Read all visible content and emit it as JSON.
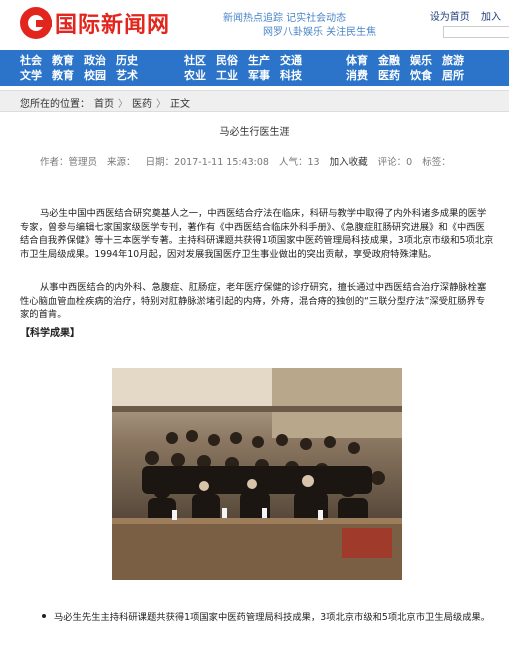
{
  "header": {
    "logo_text": "国际新闻网",
    "promo_line1": "新闻热点追踪 记实社会动态",
    "promo_line2": "网罗八卦娱乐 关注民生焦",
    "top_links": [
      "设为首页",
      "加入"
    ]
  },
  "nav": {
    "group1": [
      "社会",
      "文学",
      "教育",
      "教育",
      "政治",
      "校园",
      "历史",
      "艺术"
    ],
    "group2": [
      "社区",
      "农业",
      "民俗",
      "工业",
      "生产",
      "军事",
      "交通",
      "科技"
    ],
    "group3": [
      "体育",
      "消费",
      "金融",
      "医药",
      "娱乐",
      "饮食",
      "旅游",
      "居所"
    ]
  },
  "breadcrumb": {
    "prefix": "您所在的位置：",
    "items": [
      "首页",
      "医药",
      "正文"
    ],
    "separator": "〉"
  },
  "article": {
    "title": "马必生行医生涯",
    "meta": {
      "author": "作者：管理员",
      "source": "来源：",
      "date": "日期：2017-1-11 15:43:08",
      "views": "人气：13",
      "favorite": "加入收藏",
      "comments": "评论：0",
      "tags": "标签："
    },
    "paragraph1": "马必生中国中西医结合研究奠基人之一，中西医结合疗法在临床，科研与教学中取得了内外科诸多成果的医学专家，曾参与编辑七家国家级医学专刊，著作有《中西医结合临床外科手册》、《急腹症肛肠研究进展》和《中西医结合自我养保健》等十三本医学专著。主持科研课题共获得1项国家中医药管理局科技成果，3项北京市级和5项北京市卫生局级成果。1994年10月起，因对发展我国医疗卫生事业做出的突出贡献，享受政府特殊津贴。",
    "paragraph2": "从事中西医结合的内外科、急腹症、肛肠症，老年医疗保健的诊疗研究，擅长通过中西医结合治疗深静脉栓塞性心脑血管血栓疾病的治疗，特别对肛静脉淤堵引起的内痔，外痔，混合痔的独创的“三联分型疗法”深受肛肠界专家的首肯。",
    "section_heading": "【科学成果】",
    "bullet1": "马必生先生主持科研课题共获得1项国家中医药管理局科技成果，3项北京市级和5项北京市卫生局级成果。"
  }
}
